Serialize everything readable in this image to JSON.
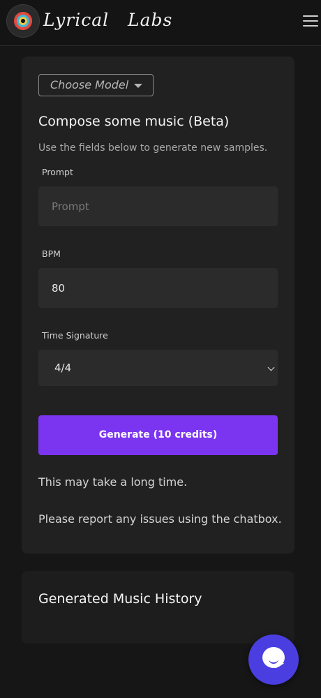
{
  "header": {
    "logo_text": "Lyrical",
    "logo_ghost_text": "Lyrical Labs",
    "logo_text_2": "Labs",
    "logo_icon": "vinyl-record-icon",
    "menu_icon": "hamburger-menu-icon"
  },
  "compose": {
    "model_select_label": "Choose Model",
    "title": "Compose some music (Beta)",
    "subtitle": "Use the fields below to generate new samples.",
    "prompt": {
      "label": "Prompt",
      "placeholder": "Prompt",
      "value": ""
    },
    "bpm": {
      "label": "BPM",
      "value": "80"
    },
    "time_signature": {
      "label": "Time Signature",
      "value": "4/4"
    },
    "generate_label": "Generate (10 credits)",
    "note_1": "This may take a long time.",
    "note_2": "Please report any issues using the chatbox."
  },
  "history": {
    "title": "Generated Music History"
  },
  "chat": {
    "icon": "chat-bubble-icon"
  },
  "colors": {
    "background": "#161616",
    "card": "#212121",
    "accent": "#7b35f0",
    "chat_button": "#4a3ee0"
  }
}
